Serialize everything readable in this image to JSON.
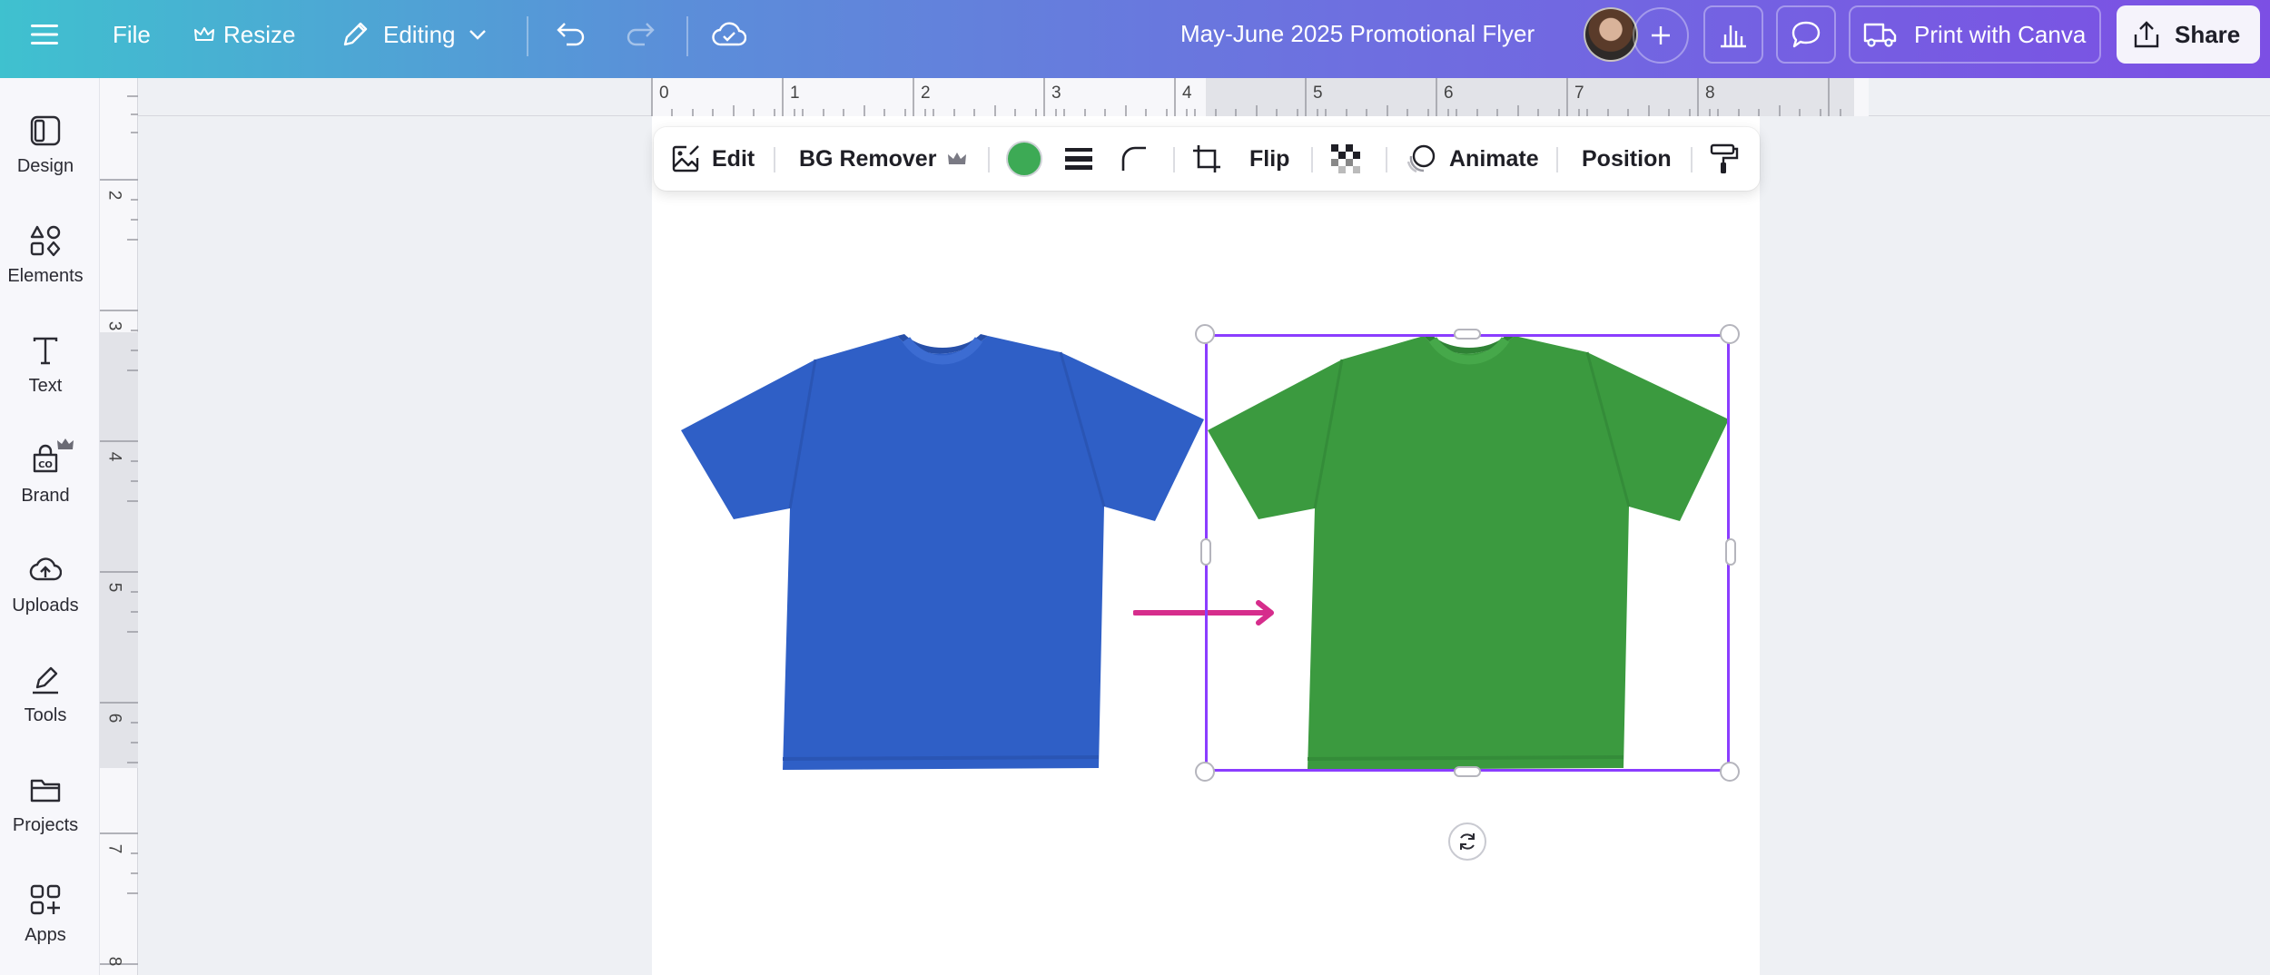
{
  "topbar": {
    "file": "File",
    "resize": "Resize",
    "editing": "Editing",
    "doc_title": "May-June 2025 Promotional Flyer",
    "print": "Print with Canva",
    "share": "Share"
  },
  "sidebar": {
    "items": [
      {
        "label": "Design",
        "icon": "design-icon"
      },
      {
        "label": "Elements",
        "icon": "elements-icon"
      },
      {
        "label": "Text",
        "icon": "text-icon"
      },
      {
        "label": "Brand",
        "icon": "brand-icon"
      },
      {
        "label": "Uploads",
        "icon": "uploads-icon"
      },
      {
        "label": "Tools",
        "icon": "tools-icon"
      },
      {
        "label": "Projects",
        "icon": "projects-icon"
      },
      {
        "label": "Apps",
        "icon": "apps-icon"
      }
    ]
  },
  "ruler": {
    "horizontal": [
      "0",
      "1",
      "2",
      "3",
      "4",
      "5",
      "6",
      "7",
      "8"
    ],
    "vertical": [
      "2",
      "3",
      "4",
      "5",
      "6",
      "7",
      "8"
    ]
  },
  "context_toolbar": {
    "edit": "Edit",
    "bg_remover": "BG Remover",
    "flip": "Flip",
    "animate": "Animate",
    "position": "Position",
    "color": "#3daa55"
  },
  "colors": {
    "blue_shirt": "#2f5fc6",
    "green_shirt": "#3b9a3f",
    "arrow": "#d62d8c",
    "selection": "#8b3dff"
  }
}
